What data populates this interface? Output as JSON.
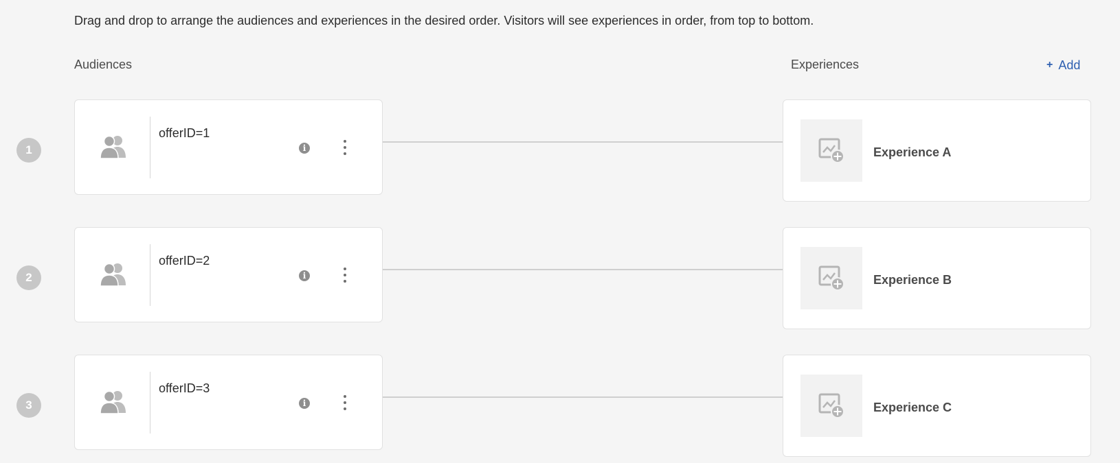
{
  "instructions": "Drag and drop to arrange the audiences and experiences in the desired order. Visitors will see experiences in order, from top to bottom.",
  "columns": {
    "audiences_label": "Audiences",
    "experiences_label": "Experiences"
  },
  "add_button": {
    "icon": "+",
    "label": "Add"
  },
  "rows": [
    {
      "number": "1",
      "audience": {
        "name": "offerID=1",
        "icon": "audience-icon"
      },
      "experience": {
        "name": "Experience A",
        "icon": "image-add-icon"
      }
    },
    {
      "number": "2",
      "audience": {
        "name": "offerID=2",
        "icon": "audience-icon"
      },
      "experience": {
        "name": "Experience B",
        "icon": "image-add-icon"
      }
    },
    {
      "number": "3",
      "audience": {
        "name": "offerID=3",
        "icon": "audience-icon"
      },
      "experience": {
        "name": "Experience C",
        "icon": "image-add-icon"
      }
    }
  ],
  "colors": {
    "background": "#f5f5f5",
    "link": "#2d5fb0",
    "badge": "#c7c7c7"
  }
}
